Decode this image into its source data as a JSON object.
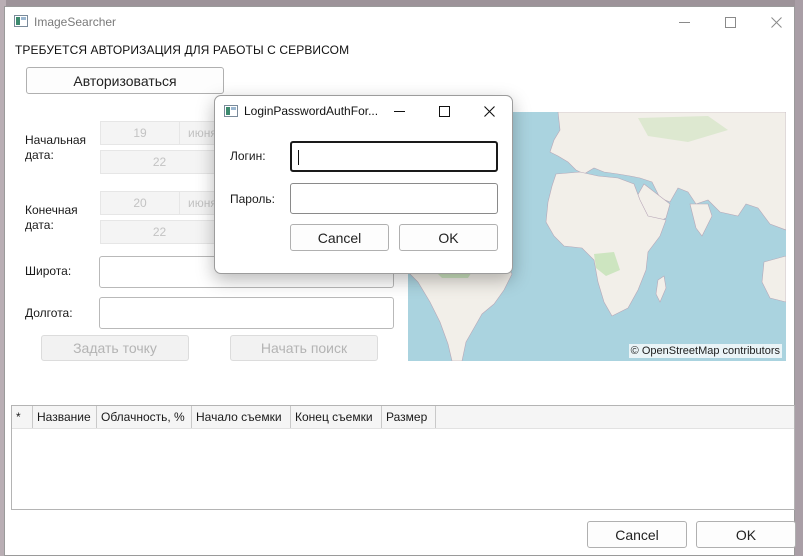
{
  "main_window": {
    "title": "ImageSearcher",
    "auth_note": "ТРЕБУЕТСЯ АВТОРИЗАЦИЯ ДЛЯ РАБОТЫ С СЕРВИСОМ",
    "auth_button": "Авторизоваться",
    "start_date": {
      "label": "Начальная дата:",
      "day": "19",
      "month": "июня",
      "hour": "22"
    },
    "end_date": {
      "label": "Конечная дата:",
      "day": "20",
      "month": "июня",
      "hour": "22"
    },
    "latitude": {
      "label": "Широта:",
      "value": ""
    },
    "longitude": {
      "label": "Долгота:",
      "value": ""
    },
    "set_point_button": "Задать точку",
    "start_search_button": "Начать поиск",
    "map_attribution": "© OpenStreetMap contributors",
    "table": {
      "columns": [
        "*",
        "Название",
        "Облачность, %",
        "Начало съемки",
        "Конец съемки",
        "Размер"
      ],
      "rows": []
    },
    "cancel_button": "Cancel",
    "ok_button": "OK"
  },
  "dialog": {
    "title": "LoginPasswordAuthFor...",
    "login_label": "Логин:",
    "login_value": "",
    "password_label": "Пароль:",
    "password_value": "",
    "cancel_button": "Cancel",
    "ok_button": "OK"
  },
  "icons": {
    "minimize": "minimize-icon",
    "maximize": "maximize-icon",
    "close": "close-icon",
    "app": "app-icon"
  },
  "colors": {
    "map_water": "#aad3df",
    "map_land": "#f2efe9",
    "map_green": "#cde5c0"
  }
}
